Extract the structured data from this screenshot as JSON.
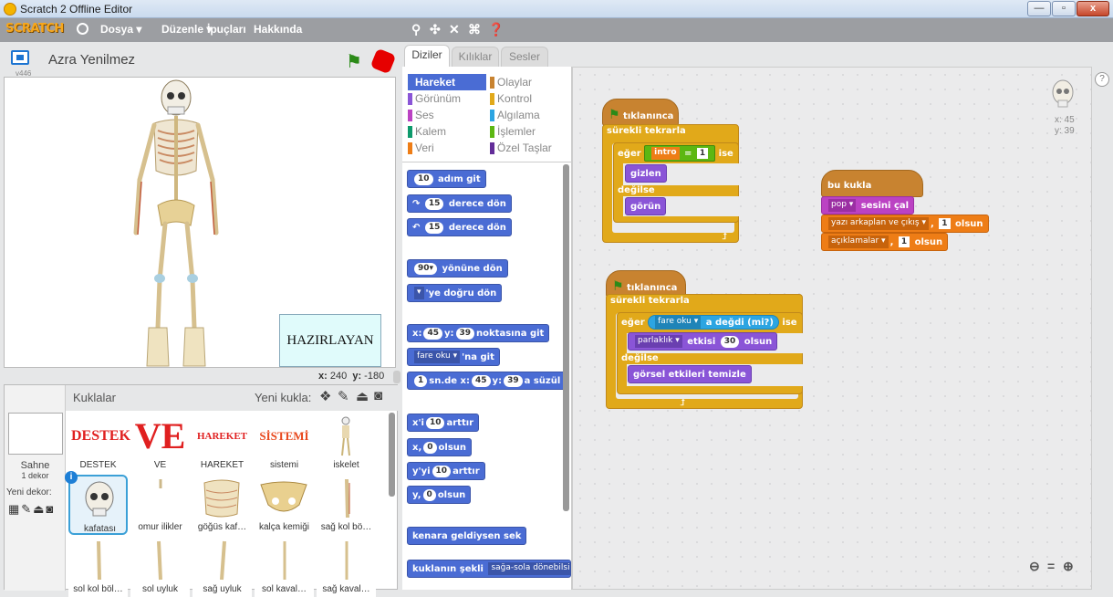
{
  "window": {
    "title": "Scratch 2 Offline Editor",
    "minimize": "—",
    "maximize": "▫",
    "close": "x"
  },
  "menubar": {
    "logo": "SCRATCH",
    "items": [
      "Dosya ▾",
      "Düzenle ▾",
      "İpuçları",
      "Hakkında"
    ]
  },
  "stage": {
    "project_title": "Azra Yenilmez",
    "version": "v446",
    "hazirlayan": "HAZIRLAYAN",
    "coords": {
      "x_label": "x:",
      "x": "240",
      "y_label": "y:",
      "y": "-180"
    }
  },
  "sprites": {
    "header": "Kuklalar",
    "new_sprite": "Yeni kukla:",
    "stage_label": "Sahne",
    "stage_decor": "1 dekor",
    "new_backdrop": "Yeni dekor:",
    "items": [
      {
        "name": "DESTEK",
        "thumb_text": "DESTEK"
      },
      {
        "name": "VE",
        "thumb_text": "VE"
      },
      {
        "name": "HAREKET",
        "thumb_text": "HAREKET"
      },
      {
        "name": "sistemi",
        "thumb_text": "SİSTEMİ"
      },
      {
        "name": "iskelet",
        "thumb_text": ""
      },
      {
        "name": "kafatası",
        "thumb_text": ""
      },
      {
        "name": "omur ilikler",
        "thumb_text": ""
      },
      {
        "name": "göğüs kaf…",
        "thumb_text": ""
      },
      {
        "name": "kalça kemiği",
        "thumb_text": ""
      },
      {
        "name": "sağ kol bö…",
        "thumb_text": ""
      },
      {
        "name": "sol kol böl…",
        "thumb_text": ""
      },
      {
        "name": "sol uyluk",
        "thumb_text": ""
      },
      {
        "name": "sağ uyluk",
        "thumb_text": ""
      },
      {
        "name": "sol kaval…",
        "thumb_text": ""
      },
      {
        "name": "sağ kaval…",
        "thumb_text": ""
      }
    ]
  },
  "tabs": [
    "Diziler",
    "Kılıklar",
    "Sesler"
  ],
  "categories": [
    {
      "label": "Hareket",
      "color": "#4a6cd4"
    },
    {
      "label": "Olaylar",
      "color": "#c88330"
    },
    {
      "label": "Görünüm",
      "color": "#8a55d7"
    },
    {
      "label": "Kontrol",
      "color": "#e1a91a"
    },
    {
      "label": "Ses",
      "color": "#bb42c3"
    },
    {
      "label": "Algılama",
      "color": "#2ca5e2"
    },
    {
      "label": "Kalem",
      "color": "#0e9a6c"
    },
    {
      "label": "İşlemler",
      "color": "#5cb712"
    },
    {
      "label": "Veri",
      "color": "#ee7d16"
    },
    {
      "label": "Özel Taşlar",
      "color": "#632d99"
    }
  ],
  "palette_blocks": {
    "b1": {
      "n": "10",
      "t": "adım git"
    },
    "b2": {
      "n": "15",
      "t": "derece dön"
    },
    "b3": {
      "n": "15",
      "t": "derece dön"
    },
    "b4": {
      "n": "90▾",
      "t": "yönüne dön"
    },
    "b5": {
      "n": "▾",
      "t": "'ye doğru dön"
    },
    "b6": {
      "a": "x:",
      "x": "45",
      "b": "y:",
      "y": "39",
      "t": "noktasına git"
    },
    "b7": {
      "d": "fare oku ▾",
      "t": "'na git"
    },
    "b8": {
      "n": "1",
      "a": "sn.de x:",
      "x": "45",
      "b": "y:",
      "y": "39",
      "t": "a süzül"
    },
    "b9": {
      "a": "x'i",
      "n": "10",
      "t": "arttır"
    },
    "b10": {
      "a": "x,",
      "n": "0",
      "t": "olsun"
    },
    "b11": {
      "a": "y'yi",
      "n": "10",
      "t": "arttır"
    },
    "b12": {
      "a": "y,",
      "n": "0",
      "t": "olsun"
    },
    "b13": {
      "t": "kenara geldiysen sek"
    },
    "b14": {
      "t": "kuklanın şekli",
      "d": "sağa-sola dönebilsin"
    }
  },
  "script1": {
    "hat": "tıklanınca",
    "forever": "sürekli tekrarla",
    "if": "eğer",
    "var": "intro",
    "eq": "=",
    "val": "1",
    "then": "ise",
    "hide": "gizlen",
    "else": "değilse",
    "show": "görün"
  },
  "script2": {
    "hat": "tıklanınca",
    "forever": "sürekli tekrarla",
    "if": "eğer",
    "touch_dd": "fare oku ▾",
    "touch": "a değdi (mi?)",
    "then": "ise",
    "effect_dd": "parlaklık ▾",
    "effect": "etkisi",
    "effect_val": "30",
    "effect_tail": "olsun",
    "else": "değilse",
    "clear": "görsel etkileri temizle"
  },
  "script3": {
    "hat": "bu kukla tıklanınca",
    "sound_dd": "pop ▾",
    "sound": "sesini çal",
    "var1_dd": "yazı arkaplan ve çıkış ▾",
    "var1_comma": ",",
    "var1_val": "1",
    "var1_tail": "olsun",
    "var2_dd": "açıklamalar ▾",
    "var2_comma": ",",
    "var2_val": "1",
    "var2_tail": "olsun"
  },
  "sprite_info": {
    "x": "x: 45",
    "y": "y: 39"
  },
  "zoom": {
    "out": "🔍-",
    "reset": "=",
    "in": "🔍+"
  }
}
